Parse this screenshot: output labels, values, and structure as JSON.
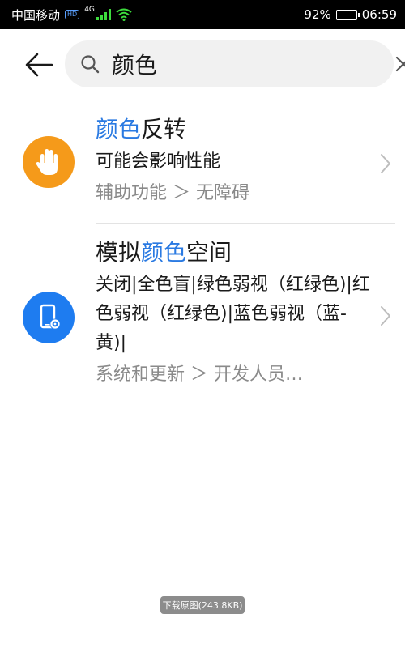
{
  "status_bar": {
    "carrier": "中国移动",
    "hd_badge": "HD",
    "network": "4G",
    "battery_text": "92%",
    "battery_level": 0.92,
    "time": "06:59"
  },
  "search": {
    "query": "颜色",
    "icons": {
      "back": "arrow-left-icon",
      "search": "search-icon",
      "clear": "close-icon"
    }
  },
  "results": [
    {
      "title_highlight": "颜色",
      "title_rest": "反转",
      "description": "可能会影响性能",
      "path": "辅助功能 ＞ 无障碍",
      "icon": "hand-icon",
      "icon_color": "#f59a1a"
    },
    {
      "title_prefix": "模拟",
      "title_highlight": "颜色",
      "title_rest": "空间",
      "description": "关闭|全色盲|绿色弱视（红绿色)|红色弱视（红绿色)|蓝色弱视（蓝-黄)|",
      "path": "系统和更新 ＞ 开发人员…",
      "icon": "phone-settings-icon",
      "icon_color": "#1e7cf0"
    }
  ],
  "highlight_color": "#2a7ae2",
  "download_button": "下载原图(243.8KB)"
}
